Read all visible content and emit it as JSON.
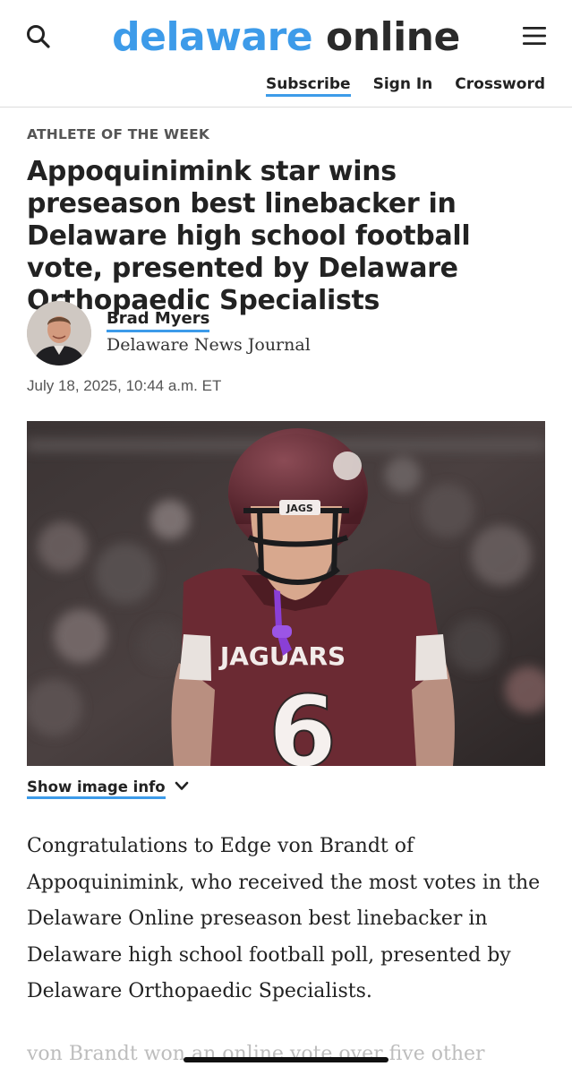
{
  "header": {
    "logo_brand": "delaware",
    "logo_rest": "online",
    "nav": {
      "subscribe": "Subscribe",
      "sign_in": "Sign In",
      "crossword": "Crossword"
    },
    "icons": [
      "search-icon",
      "hamburger-menu-icon"
    ]
  },
  "article": {
    "kicker": "ATHLETE OF THE WEEK",
    "headline": "Appoquinimink star wins preseason best linebacker in Delaware high school football vote, presented by Delaware Orthopaedic Specialists",
    "author": {
      "name": "Brad Myers",
      "org": "Delaware News Journal"
    },
    "date": "July 18, 2025, 10:44 a.m. ET",
    "image": {
      "helmet_label": "JAGS",
      "jersey_text": "JAGUARS",
      "jersey_number": "6",
      "info_label": "Show image info"
    },
    "body_paragraph": "Congratulations to Edge von Brandt of Appoquinimink, who received the most votes in the Delaware Online preseason best linebacker in Delaware high school football poll, presented by Delaware Orthopaedic Specialists.",
    "body_next_faded": "von Brandt won an online vote over five other"
  },
  "colors": {
    "brand_blue": "#3d9be9",
    "text": "#222222",
    "jersey_maroon": "#6b2a33",
    "mouthguard_purple": "#8a3fd6"
  }
}
